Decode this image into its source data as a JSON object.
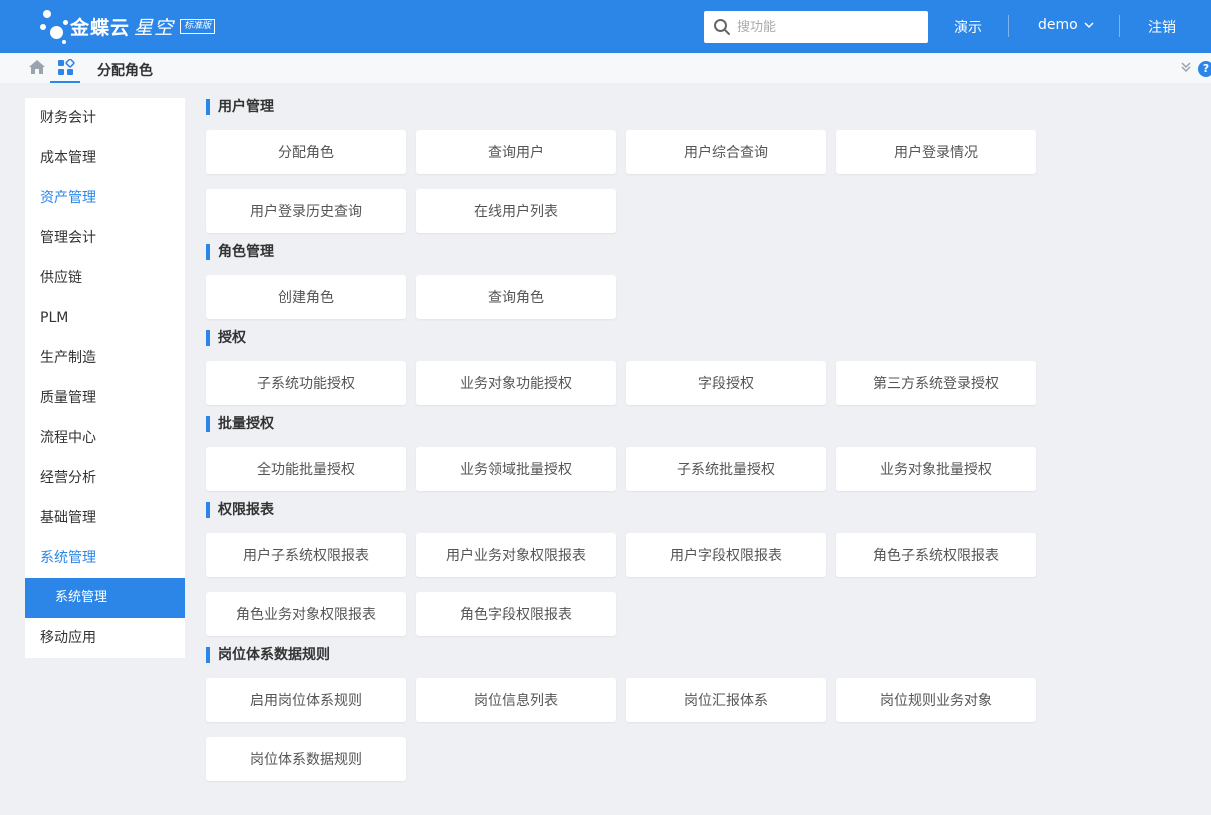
{
  "header": {
    "brand": "金蝶云",
    "brand_sub": "星空",
    "edition_badge": "标准版",
    "search_placeholder": "搜功能",
    "demo_link": "演示",
    "user_menu": "demo",
    "logout": "注销"
  },
  "breadcrumb": {
    "title": "分配角色"
  },
  "sidebar": {
    "items": [
      {
        "label": "财务会计"
      },
      {
        "label": "成本管理"
      },
      {
        "label": "资产管理"
      },
      {
        "label": "管理会计"
      },
      {
        "label": "供应链"
      },
      {
        "label": "PLM"
      },
      {
        "label": "生产制造"
      },
      {
        "label": "质量管理"
      },
      {
        "label": "流程中心"
      },
      {
        "label": "经营分析"
      },
      {
        "label": "基础管理"
      },
      {
        "label": "系统管理"
      },
      {
        "label": "系统管理"
      },
      {
        "label": "移动应用"
      }
    ]
  },
  "sections": [
    {
      "title": "用户管理",
      "items": [
        "分配角色",
        "查询用户",
        "用户综合查询",
        "用户登录情况",
        "用户登录历史查询",
        "在线用户列表"
      ]
    },
    {
      "title": "角色管理",
      "items": [
        "创建角色",
        "查询角色"
      ]
    },
    {
      "title": "授权",
      "items": [
        "子系统功能授权",
        "业务对象功能授权",
        "字段授权",
        "第三方系统登录授权"
      ]
    },
    {
      "title": "批量授权",
      "items": [
        "全功能批量授权",
        "业务领域批量授权",
        "子系统批量授权",
        "业务对象批量授权"
      ]
    },
    {
      "title": "权限报表",
      "items": [
        "用户子系统权限报表",
        "用户业务对象权限报表",
        "用户字段权限报表",
        "角色子系统权限报表",
        "角色业务对象权限报表",
        "角色字段权限报表"
      ]
    },
    {
      "title": "岗位体系数据规则",
      "items": [
        "启用岗位体系规则",
        "岗位信息列表",
        "岗位汇报体系",
        "岗位规则业务对象",
        "岗位体系数据规则"
      ]
    }
  ],
  "colors": {
    "accent": "#2b86e8",
    "background": "#eef0f4"
  }
}
